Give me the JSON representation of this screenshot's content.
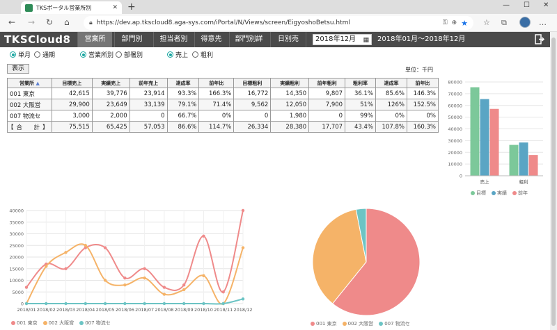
{
  "browser": {
    "tab_title": "TKSポータル営業所別",
    "url": "https://dev.ap.tkscloud8.aga-sys.com/iPortal/N/Views/screen/EigyoshoBetsu.html"
  },
  "app": {
    "logo": "TKSCloud8",
    "nav": [
      "営業所別",
      "部門別",
      "担当者別",
      "得意先別",
      "部門別詳細",
      "日別売上"
    ],
    "date_value": "2018年12月",
    "period": "2018年01月～2018年12月"
  },
  "filters": {
    "period_options": [
      "単月",
      "通期"
    ],
    "group_options": [
      "営業所別",
      "部署別"
    ],
    "metric_options": [
      "売上",
      "粗利"
    ],
    "show_button": "表示",
    "unit": "単位：千円"
  },
  "table": {
    "headers": [
      "営業所",
      "目標売上",
      "実績売上",
      "前年売上",
      "達成率",
      "前年比",
      "目標粗利",
      "実績粗利",
      "前年粗利",
      "粗利率",
      "達成率",
      "前年比"
    ],
    "rows": [
      [
        "001 東京",
        "42,615",
        "39,776",
        "23,914",
        "93.3%",
        "166.3%",
        "16,772",
        "14,350",
        "9,807",
        "36.1%",
        "85.6%",
        "146.3%"
      ],
      [
        "002 大阪営",
        "29,900",
        "23,649",
        "33,139",
        "79.1%",
        "71.4%",
        "9,562",
        "12,050",
        "7,900",
        "51%",
        "126%",
        "152.5%"
      ],
      [
        "007 物流セ",
        "3,000",
        "2,000",
        "0",
        "66.7%",
        "0%",
        "0",
        "1,980",
        "0",
        "99%",
        "0%",
        "0%"
      ],
      [
        "【合　計】",
        "75,515",
        "65,425",
        "57,053",
        "86.6%",
        "114.7%",
        "26,334",
        "28,380",
        "17,707",
        "43.4%",
        "107.8%",
        "160.3%"
      ]
    ]
  },
  "colors": {
    "target": "#7cc89a",
    "actual": "#5aa5c4",
    "prev": "#ef8a8a",
    "tokyo": "#ef8a8a",
    "osaka": "#f5b368",
    "logistics": "#6cc4c4"
  },
  "chart_data": [
    {
      "type": "bar",
      "categories": [
        "売上",
        "粗利"
      ],
      "series": [
        {
          "name": "目標",
          "values": [
            75515,
            26334
          ]
        },
        {
          "name": "実績",
          "values": [
            65425,
            28380
          ]
        },
        {
          "name": "前年",
          "values": [
            57053,
            17707
          ]
        }
      ],
      "ylim": [
        0,
        80000
      ],
      "yticks": [
        0,
        10000,
        20000,
        30000,
        40000,
        50000,
        60000,
        70000,
        80000
      ],
      "legend": "bottom"
    },
    {
      "type": "line",
      "x": [
        "2018/01",
        "2018/02",
        "2018/03",
        "2018/04",
        "2018/05",
        "2018/06",
        "2018/07",
        "2018/08",
        "2018/09",
        "2018/10",
        "2018/11",
        "2018/12"
      ],
      "series": [
        {
          "name": "001 東京",
          "values": [
            7000,
            17000,
            15000,
            24000,
            24000,
            11000,
            15000,
            7000,
            8000,
            29000,
            5000,
            40000
          ]
        },
        {
          "name": "002 大阪営",
          "values": [
            0,
            16000,
            22000,
            25000,
            10000,
            8000,
            11000,
            4000,
            6000,
            12000,
            0,
            24000
          ]
        },
        {
          "name": "007 物流セ",
          "values": [
            0,
            0,
            0,
            0,
            0,
            0,
            0,
            0,
            0,
            0,
            0,
            2000
          ]
        }
      ],
      "ylim": [
        0,
        40000
      ],
      "yticks": [
        0,
        5000,
        10000,
        15000,
        20000,
        25000,
        30000,
        35000,
        40000
      ],
      "legend": "bottom"
    },
    {
      "type": "pie",
      "labels": [
        "001 東京",
        "002 大阪営",
        "007 物流セ"
      ],
      "values": [
        39776,
        23649,
        2000
      ],
      "legend": "bottom"
    }
  ]
}
